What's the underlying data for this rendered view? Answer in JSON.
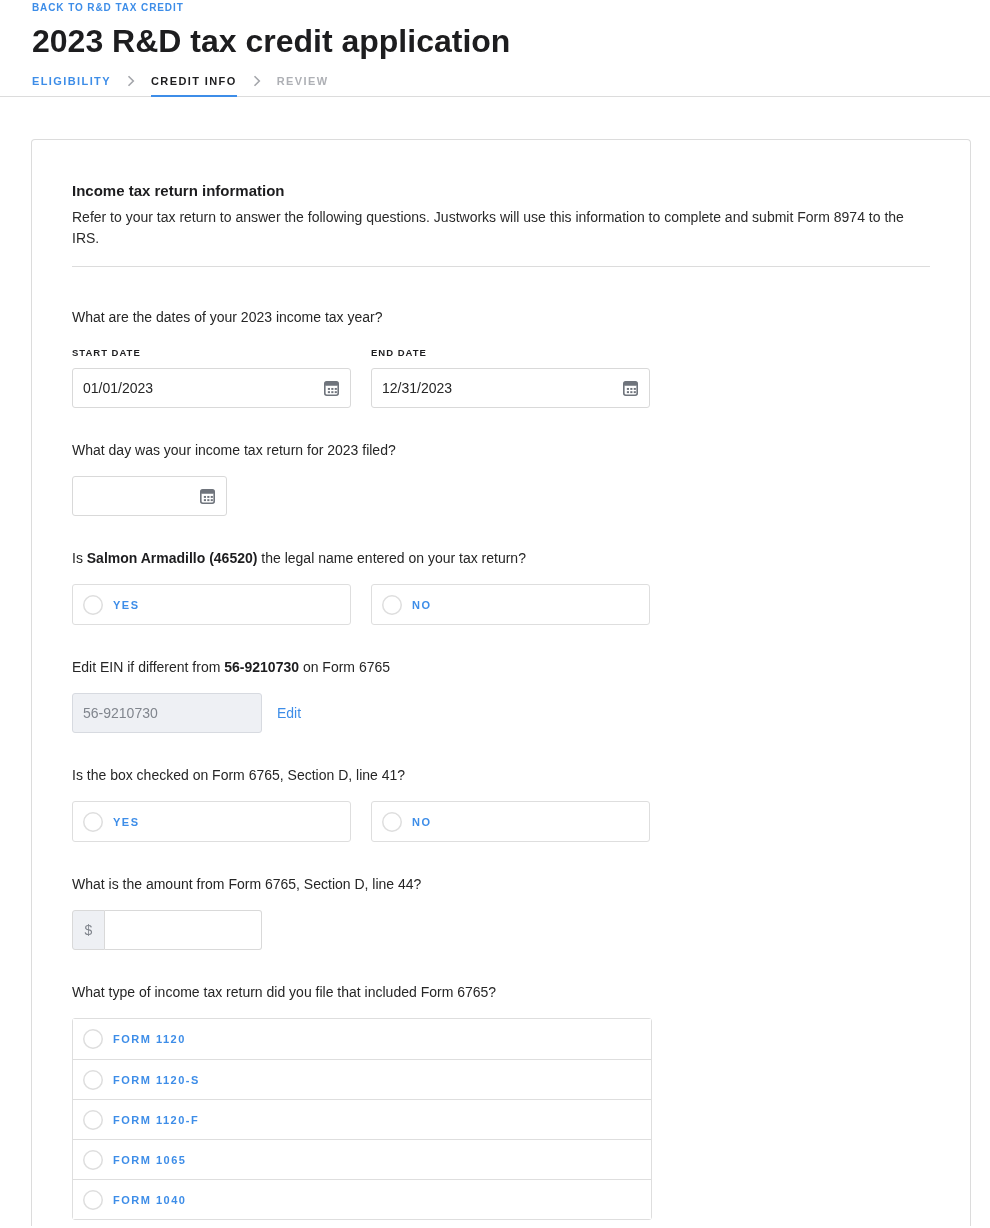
{
  "header": {
    "back_link": "BACK TO R&D TAX CREDIT",
    "title": "2023 R&D tax credit application"
  },
  "steps": [
    {
      "label": "ELIGIBILITY",
      "completed": true,
      "selected": false
    },
    {
      "label": "CREDIT INFO",
      "completed": false,
      "selected": true
    },
    {
      "label": "REVIEW",
      "completed": false,
      "selected": false
    }
  ],
  "section": {
    "title": "Income tax return information",
    "description": "Refer to your tax return to answer the following questions. Justworks will use this information to complete and submit Form 8974 to the IRS."
  },
  "questions": [
    {
      "kind": "date_range",
      "question": "What are the dates of your 2023 income tax year?",
      "fields": [
        {
          "label": "START DATE",
          "value": "01/01/2023"
        },
        {
          "label": "END DATE",
          "value": "12/31/2023"
        }
      ]
    },
    {
      "kind": "date",
      "question": "What day was your income tax return for 2023 filed?"
    },
    {
      "kind": "radio_pair",
      "question": "Is **Salmon Armadillo (46520)** the legal name entered on your tax return?",
      "options": [
        {
          "label": "YES",
          "selected": false
        },
        {
          "label": "NO",
          "selected": false
        }
      ]
    },
    {
      "kind": "locked_text",
      "question": "Edit EIN if different from **56-9210730** on Form 6765",
      "value": "56-9210730",
      "disabled": true,
      "action": "Edit"
    },
    {
      "kind": "radio_pair",
      "question": "Is the box checked on Form 6765, Section D, line 41?",
      "options": [
        {
          "label": "YES",
          "selected": false
        },
        {
          "label": "NO",
          "selected": false
        }
      ]
    },
    {
      "kind": "currency",
      "question": "What is the amount from Form 6765, Section D, line 44?",
      "prefix": "$"
    },
    {
      "kind": "radio_list",
      "question": "What type of income tax return did you file that included Form 6765?",
      "options": [
        {
          "label": "FORM 1120",
          "selected": false
        },
        {
          "label": "FORM 1120-S",
          "selected": false
        },
        {
          "label": "FORM 1120-F",
          "selected": false
        },
        {
          "label": "FORM 1065",
          "selected": false
        },
        {
          "label": "FORM 1040",
          "selected": false
        }
      ]
    }
  ]
}
